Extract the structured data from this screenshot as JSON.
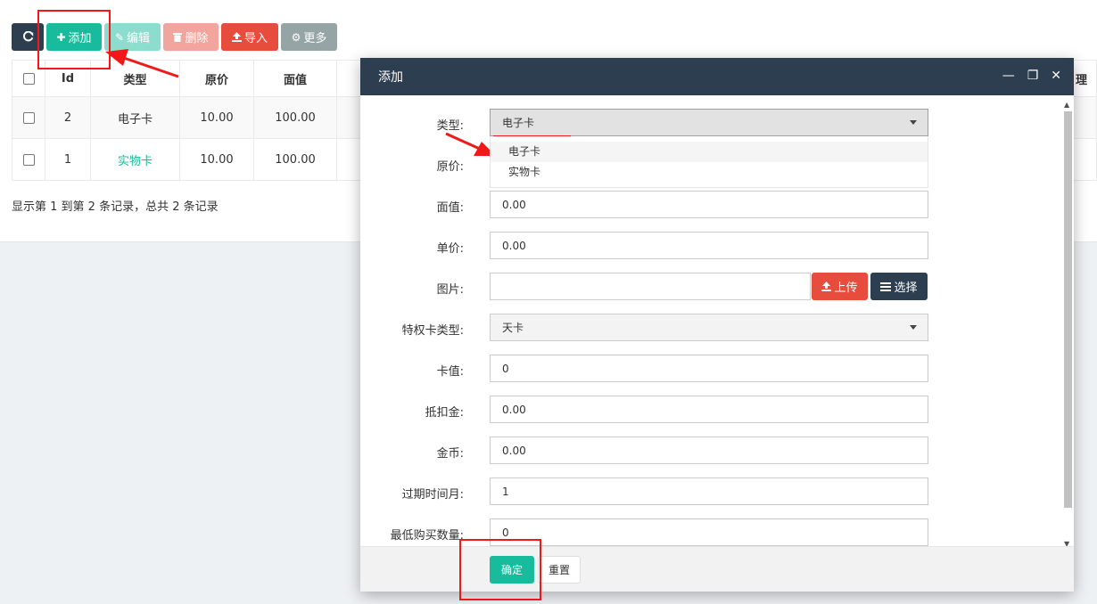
{
  "toolbar": {
    "refresh_icon": "refresh-icon",
    "add_label": "添加",
    "edit_label": "编辑",
    "delete_label": "删除",
    "import_label": "导入",
    "more_label": "更多"
  },
  "table": {
    "headers": [
      "Id",
      "类型",
      "原价",
      "面值"
    ],
    "header_edge": "理",
    "rows": [
      {
        "id": "2",
        "type": "电子卡",
        "original_price": "10.00",
        "face_value": "100.00"
      },
      {
        "id": "1",
        "type": "实物卡",
        "original_price": "10.00",
        "face_value": "100.00"
      }
    ]
  },
  "pager": {
    "info": "显示第 1 到第 2 条记录，总共 2 条记录"
  },
  "modal": {
    "title": "添加",
    "fields": {
      "type": {
        "label": "类型:",
        "value": "电子卡",
        "options": [
          "电子卡",
          "实物卡"
        ]
      },
      "original_price": {
        "label": "原价:"
      },
      "face_value": {
        "label": "面值:",
        "value": "0.00"
      },
      "unit_price": {
        "label": "单价:",
        "value": "0.00"
      },
      "image": {
        "label": "图片:",
        "value": "",
        "upload_label": "上传",
        "choose_label": "选择"
      },
      "privilege_type": {
        "label": "特权卡类型:",
        "value": "天卡"
      },
      "card_value": {
        "label": "卡值:",
        "value": "0"
      },
      "deduction": {
        "label": "抵扣金:",
        "value": "0.00"
      },
      "coins": {
        "label": "金币:",
        "value": "0.00"
      },
      "expire_months": {
        "label": "过期时间月:",
        "value": "1"
      },
      "min_qty": {
        "label": "最低购买数量:",
        "value": "0"
      }
    },
    "confirm_label": "确定",
    "reset_label": "重置"
  },
  "colors": {
    "primary": "#18bc9c",
    "danger": "#e74c3c",
    "dark": "#2c3e50",
    "annotation": "#f01818"
  }
}
